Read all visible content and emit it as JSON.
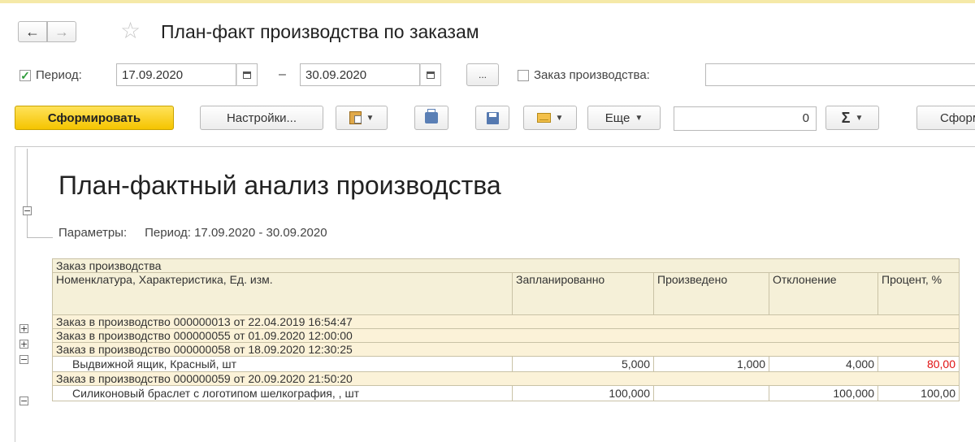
{
  "window": {
    "title": "План-факт производства по заказам"
  },
  "nav": {
    "back": "←",
    "forward": "→",
    "favorite": "☆"
  },
  "filters": {
    "period_label": "Период:",
    "date_from": "17.09.2020",
    "date_to": "30.09.2020",
    "dash": "–",
    "more": "...",
    "order_label": "Заказ производства:",
    "order_value": ""
  },
  "toolbar": {
    "generate": "Сформировать",
    "settings": "Настройки...",
    "more": "Еще",
    "sum_value": "0",
    "sum_glyph": "Σ",
    "generate2": "Сформ"
  },
  "report": {
    "title": "План-фактный анализ производства",
    "params_label": "Параметры:",
    "params_value": "Период: 17.09.2020 - 30.09.2020",
    "header": {
      "group": "Заказ производства",
      "nomenclature": "Номенклатура, Характеристика, Ед. изм.",
      "planned": "Запланированно",
      "produced": "Произведено",
      "deviation": "Отклонение",
      "percent": "Процент, %"
    },
    "rows": [
      {
        "order": "Заказ в производство 000000013 от 22.04.2019 16:54:47",
        "expander": "+"
      },
      {
        "order": "Заказ в производство 000000055 от 01.09.2020 12:00:00",
        "expander": "+"
      },
      {
        "order": "Заказ в производство 000000058 от 18.09.2020 12:30:25",
        "expander": "−",
        "item": "Выдвижной ящик, Красный, шт",
        "planned": "5,000",
        "produced": "1,000",
        "deviation": "4,000",
        "percent": "80,00"
      },
      {
        "order": "Заказ в производство 000000059 от 20.09.2020 21:50:20",
        "expander": "−",
        "item": "Силиконовый браслет с логотипом шелкография, , шт",
        "planned": "100,000",
        "produced": "",
        "deviation": "100,000",
        "percent": "100,00"
      }
    ],
    "colors": {
      "negative_percent": "#e01010",
      "header_bg": "#f5f0d8",
      "group_bg": "#fbf2d8",
      "primary_button": "#f5c400"
    }
  }
}
